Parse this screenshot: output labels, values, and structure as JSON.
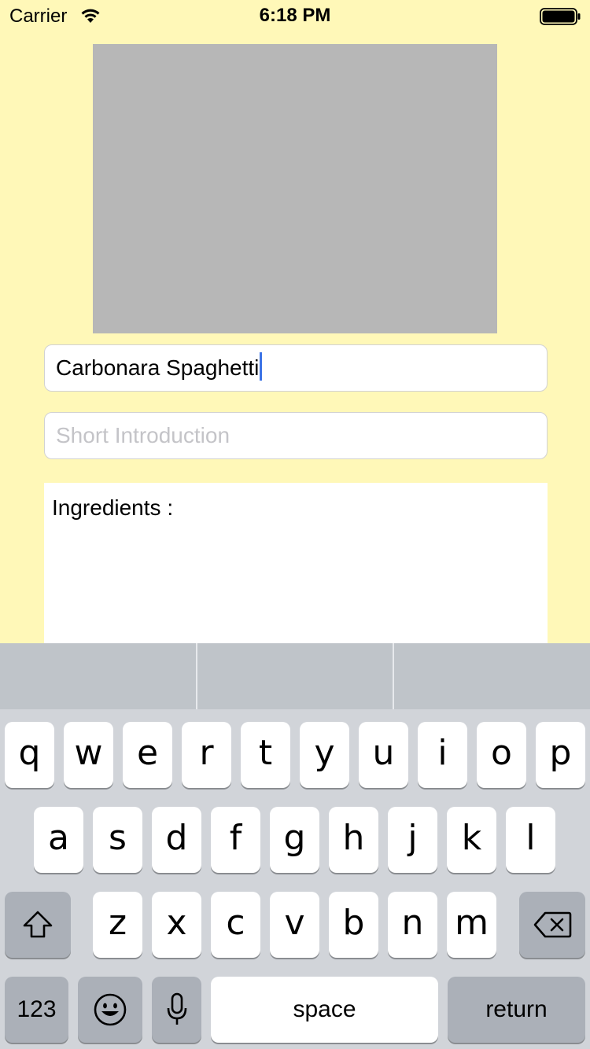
{
  "status_bar": {
    "carrier": "Carrier",
    "time": "6:18 PM",
    "wifi_icon": "wifi-icon",
    "battery_icon": "battery-icon"
  },
  "form": {
    "title_field": {
      "value": "Carbonara Spaghetti"
    },
    "intro_field": {
      "placeholder": "Short Introduction",
      "value": ""
    },
    "ingredients_area": {
      "value": "Ingredients :"
    }
  },
  "keyboard": {
    "row1": [
      "q",
      "w",
      "e",
      "r",
      "t",
      "y",
      "u",
      "i",
      "o",
      "p"
    ],
    "row2": [
      "a",
      "s",
      "d",
      "f",
      "g",
      "h",
      "j",
      "k",
      "l"
    ],
    "row3": [
      "z",
      "x",
      "c",
      "v",
      "b",
      "n",
      "m"
    ],
    "numbers_key": "123",
    "space_key": "space",
    "return_key": "return",
    "icons": {
      "shift": "shift-icon",
      "delete": "backspace-icon",
      "emoji": "emoji-icon",
      "mic": "microphone-icon"
    }
  },
  "colors": {
    "background": "#fff8b8",
    "photo_placeholder": "#b7b7b7",
    "cursor": "#3c73e6",
    "keyboard_bg": "#d1d4d9"
  }
}
